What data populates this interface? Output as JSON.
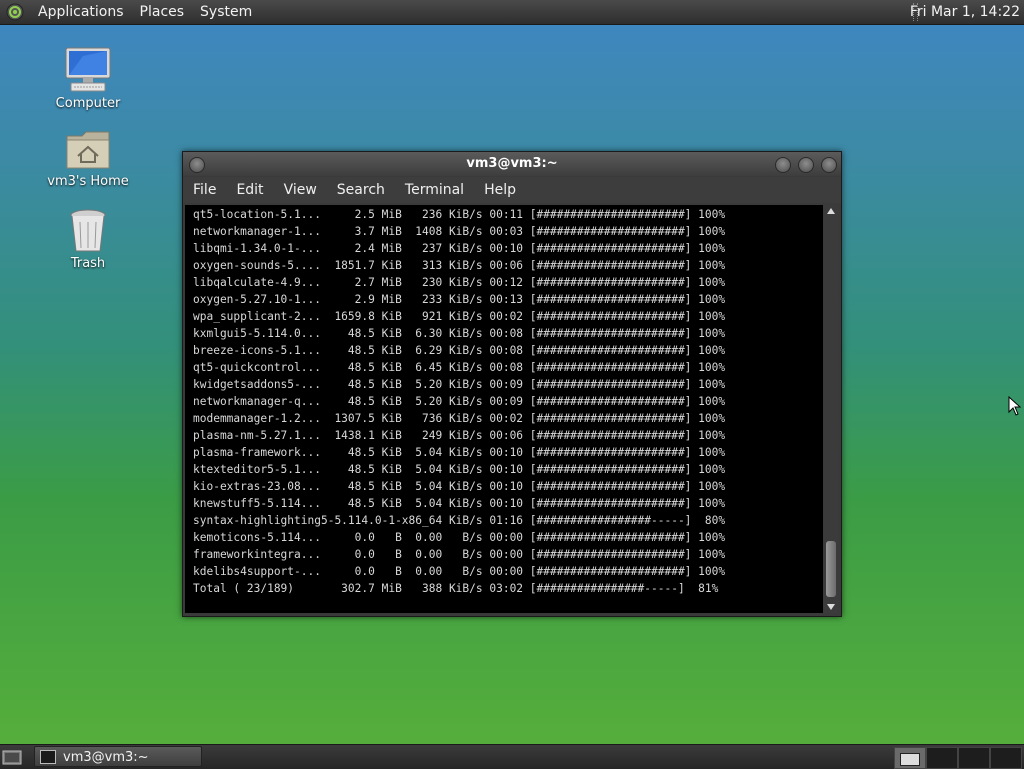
{
  "top_panel": {
    "menus": [
      "Applications",
      "Places",
      "System"
    ],
    "clock": "Fri Mar  1, 14:22"
  },
  "desktop": {
    "icons": [
      {
        "label": "Computer",
        "icon": "computer-icon"
      },
      {
        "label": "vm3's Home",
        "icon": "home-folder-icon"
      },
      {
        "label": "Trash",
        "icon": "trash-icon"
      }
    ]
  },
  "terminal": {
    "title": "vm3@vm3:~",
    "menu": [
      "File",
      "Edit",
      "View",
      "Search",
      "Terminal",
      "Help"
    ],
    "lines": [
      "qt5-location-5.1...     2.5 MiB   236 KiB/s 00:11 [######################] 100%",
      "networkmanager-1...     3.7 MiB  1408 KiB/s 00:03 [######################] 100%",
      "libqmi-1.34.0-1-...     2.4 MiB   237 KiB/s 00:10 [######################] 100%",
      "oxygen-sounds-5....  1851.7 KiB   313 KiB/s 00:06 [######################] 100%",
      "libqalculate-4.9...     2.7 MiB   230 KiB/s 00:12 [######################] 100%",
      "oxygen-5.27.10-1...     2.9 MiB   233 KiB/s 00:13 [######################] 100%",
      "wpa_supplicant-2...  1659.8 KiB   921 KiB/s 00:02 [######################] 100%",
      "kxmlgui5-5.114.0...    48.5 KiB  6.30 KiB/s 00:08 [######################] 100%",
      "breeze-icons-5.1...    48.5 KiB  6.29 KiB/s 00:08 [######################] 100%",
      "qt5-quickcontrol...    48.5 KiB  6.45 KiB/s 00:08 [######################] 100%",
      "kwidgetsaddons5-...    48.5 KiB  5.20 KiB/s 00:09 [######################] 100%",
      "networkmanager-q...    48.5 KiB  5.20 KiB/s 00:09 [######################] 100%",
      "modemmanager-1.2...  1307.5 KiB   736 KiB/s 00:02 [######################] 100%",
      "plasma-nm-5.27.1...  1438.1 KiB   249 KiB/s 00:06 [######################] 100%",
      "plasma-framework...    48.5 KiB  5.04 KiB/s 00:10 [######################] 100%",
      "ktexteditor5-5.1...    48.5 KiB  5.04 KiB/s 00:10 [######################] 100%",
      "kio-extras-23.08...    48.5 KiB  5.04 KiB/s 00:10 [######################] 100%",
      "knewstuff5-5.114...    48.5 KiB  5.04 KiB/s 00:10 [######################] 100%",
      "syntax-highlighting5-5.114.0-1-x86_64 KiB/s 01:16 [#################-----]  80%",
      "kemoticons-5.114...     0.0   B  0.00   B/s 00:00 [######################] 100%",
      "frameworkintegra...     0.0   B  0.00   B/s 00:00 [######################] 100%",
      "kdelibs4support-...     0.0   B  0.00   B/s 00:00 [######################] 100%",
      "Total ( 23/189)       302.7 MiB   388 KiB/s 03:02 [################-----]  81%"
    ]
  },
  "taskbar": {
    "task_label": "vm3@vm3:~",
    "workspaces": 4,
    "active_workspace": 1
  }
}
